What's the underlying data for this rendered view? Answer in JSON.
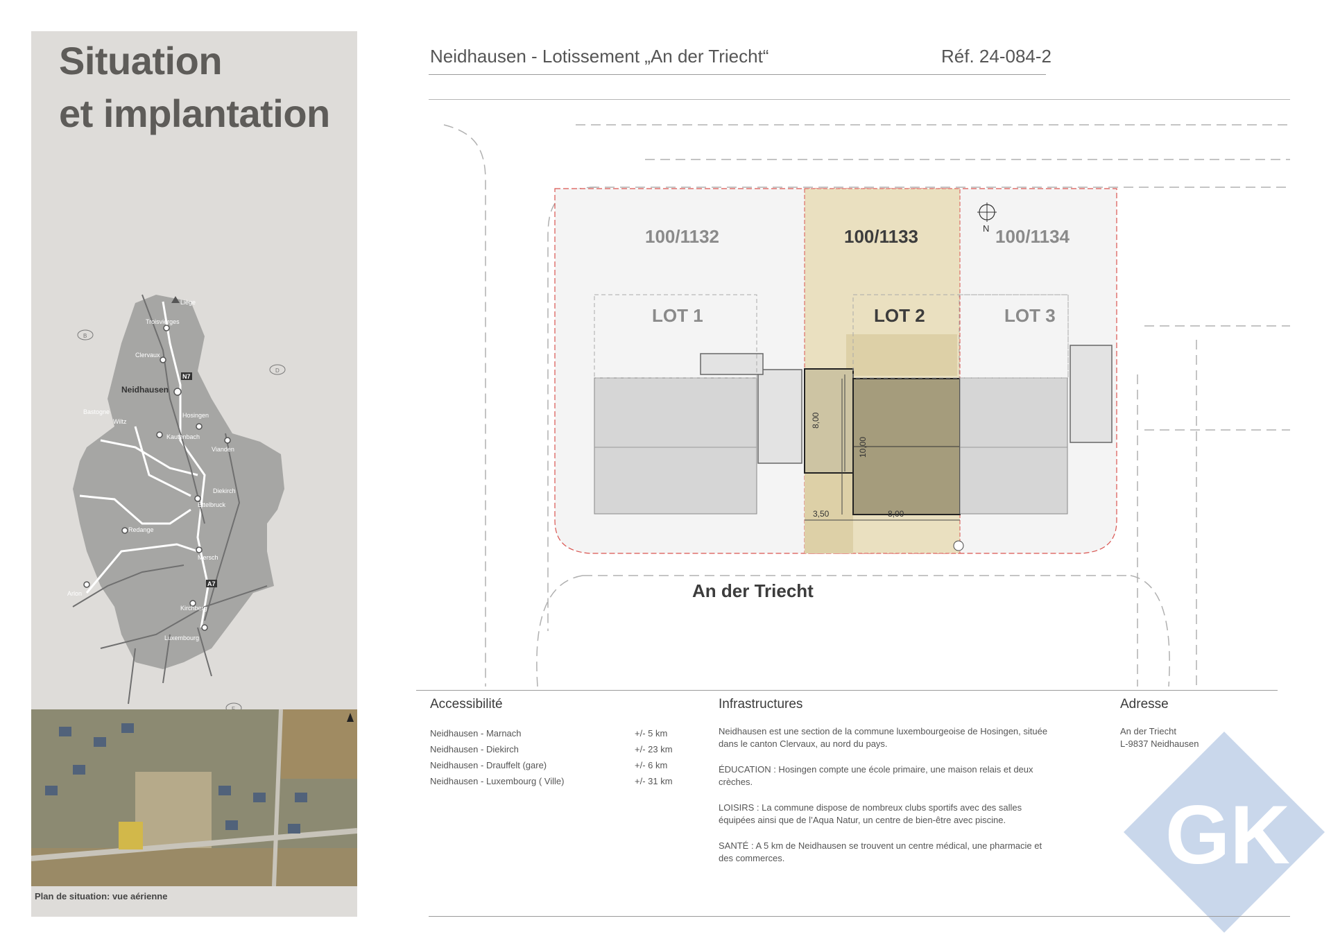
{
  "title": {
    "line1": "Situation",
    "line2": "et implantation"
  },
  "header": {
    "project": "Neidhausen - Lotissement „An der Triecht“",
    "ref": "Réf. 24-084-2"
  },
  "map": {
    "labels": {
      "liege": "Liège",
      "troisvierges": "Troisvierges",
      "clervaux": "Clervaux",
      "n7": "N7",
      "neidhausen": "Neidhausen",
      "hosingen": "Hosingen",
      "bastogne": "Bastogne",
      "wiltz": "Wiltz",
      "kautenbach": "Kautenbach",
      "vianden": "Vianden",
      "diekirch": "Diekirch",
      "ettelbruck": "Ettelbruck",
      "redange": "Redange",
      "mersch": "Mersch",
      "a7": "A7",
      "arlon": "Arlon",
      "kirchberg": "Kirchberg",
      "luxembourg": "Luxembourg",
      "b": "B",
      "d": "D",
      "f": "F"
    }
  },
  "aerial": {
    "caption": "Plan de situation: vue aérienne"
  },
  "plan": {
    "parcels": [
      "100/1132",
      "100/1133",
      "100/1134"
    ],
    "lots": [
      "LOT 1",
      "LOT 2",
      "LOT 3"
    ],
    "north": "N",
    "street": "An der Triecht",
    "dimensions": {
      "d1": "8,00",
      "d2": "10,00",
      "d3": "3,50",
      "d4": "8,00"
    }
  },
  "accessibilite": {
    "title": "Accessibilité",
    "rows": [
      {
        "route": "Neidhausen  - Marnach",
        "distance": "+/-  5  km"
      },
      {
        "route": "Neidhausen  - Diekirch",
        "distance": "+/-  23 km"
      },
      {
        "route": "Neidhausen  - Drauffelt (gare)",
        "distance": "+/-  6  km"
      },
      {
        "route": "Neidhausen  - Luxembourg ( Ville)",
        "distance": "+/-  31 km"
      }
    ]
  },
  "infrastructures": {
    "title": "Infrastructures",
    "p1": "Neidhausen est une section de la commune luxembourgeoise de Hosingen, située dans le canton Clervaux,  au nord du pays.",
    "p2": "ÉDUCATION : Hosingen compte une école primaire,  une maison relais et deux crèches.",
    "p3": "LOISIRS : La commune dispose de nombreux clubs sportifs avec des salles équipées ainsi que de l’Aqua Natur, un centre de bien-être avec piscine.",
    "p4": "SANTÉ : A 5 km de Neidhausen se trouvent un centre médical, une pharmacie et des commerces."
  },
  "adresse": {
    "title": "Adresse",
    "line1": "An der Triecht",
    "line2": "L-9837 Neidhausen"
  },
  "logo": {
    "text": "GK",
    "color": "#c9d7eb"
  }
}
